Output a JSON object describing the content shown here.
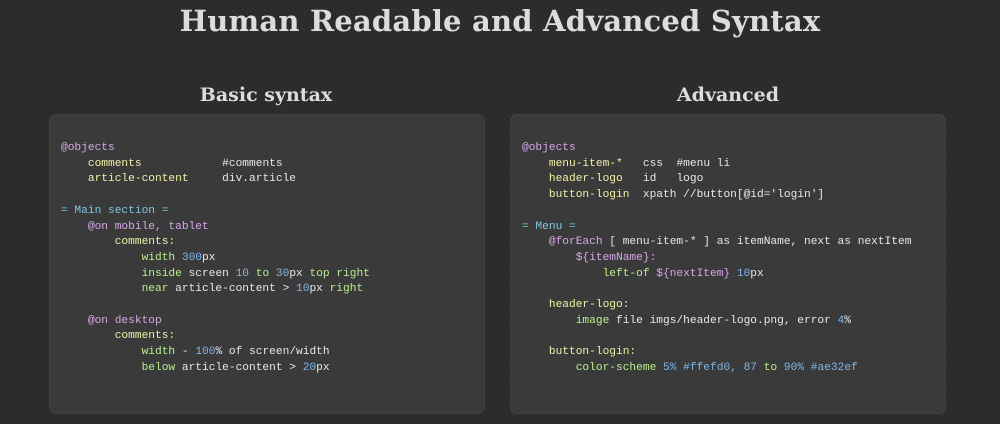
{
  "page": {
    "title": "Human Readable and Advanced Syntax"
  },
  "basic": {
    "title": "Basic syntax",
    "t_objects": "@objects",
    "t_comments": "comments",
    "t_comments_loc": "#comments",
    "t_article_content": "article-content",
    "t_article_loc": "div.article",
    "t_main_section": "= Main section =",
    "t_on_mobile": "@on mobile, tablet",
    "t_comments_colon": "comments:",
    "t_width": "width",
    "t_300": "300",
    "t_px": "px",
    "t_inside": "inside",
    "t_screen": " screen ",
    "t_10": "10",
    "t_to": " to ",
    "t_30": "30",
    "t_px2": "px ",
    "t_top_right": "top right",
    "t_near": "near",
    "t_near_obj": " article-content > ",
    "t_10b": "10",
    "t_px3": "px ",
    "t_right": "right",
    "t_on_desktop": "@on desktop",
    "t_comments_colon2": "comments:",
    "t_width2": "width",
    "t_dash": " - ",
    "t_100": "100",
    "t_pct": "% of screen/width",
    "t_below": "below",
    "t_below_obj": " article-content > ",
    "t_20": "20",
    "t_px4": "px"
  },
  "advanced": {
    "title": "Advanced",
    "t_objects": "@objects",
    "t_menu_item": "menu-item-*",
    "t_css": "css",
    "t_menu_loc": "#menu li",
    "t_header_logo": "header-logo",
    "t_id": "id",
    "t_logo": "logo",
    "t_button_login": "button-login",
    "t_xpath": "xpath //button[@id='login']",
    "t_menu_section": "= Menu =",
    "t_foreach": "@forEach",
    "t_foreach_rest": " [ menu-item-* ] as itemName, next as nextItem",
    "t_itemname": "${itemName}:",
    "t_left_of": "left-of",
    "t_nextitem": " ${nextItem} ",
    "t_10": "10",
    "t_px": "px",
    "t_header_logo_colon": "header-logo:",
    "t_image": "image",
    "t_image_rest": " file imgs/header-logo.png, error ",
    "t_4": "4",
    "t_pct": "%",
    "t_button_login_colon": "button-login:",
    "t_color_scheme": "color-scheme",
    "t_5": " 5",
    "t_pct_ff": "% #ffefd0, ",
    "t_87": "87",
    "t_to": " to ",
    "t_90": "90",
    "t_pct_ae": "% #ae32ef"
  }
}
